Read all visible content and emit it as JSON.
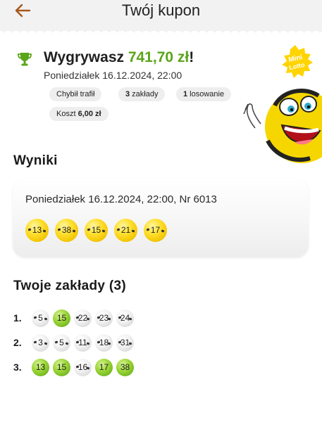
{
  "header": {
    "title": "Twój kupon"
  },
  "win": {
    "prefix": "Wygrywasz ",
    "amount": "741,70 zł",
    "suffix": "!",
    "date": "Poniedziałek 16.12.2024, 22:00"
  },
  "chips": {
    "chybil": "Chybił trafił",
    "bets_count": "3",
    "bets_label": " zakłady",
    "draws_count": "1",
    "draws_label": " losowanie",
    "cost_label": "Koszt ",
    "cost_value": "6,00 zł"
  },
  "brand": {
    "logo_line1": "Mini",
    "logo_line2": "Lotto"
  },
  "results": {
    "heading": "Wyniki",
    "draw_info": "Poniedziałek 16.12.2024, 22:00, Nr 6013",
    "numbers": [
      "13",
      "38",
      "15",
      "21",
      "17"
    ]
  },
  "bets": {
    "heading": "Twoje zakłady (3)",
    "rows": [
      {
        "label": "1.",
        "balls": [
          {
            "n": "5",
            "hit": false
          },
          {
            "n": "15",
            "hit": true
          },
          {
            "n": "22",
            "hit": false
          },
          {
            "n": "23",
            "hit": false
          },
          {
            "n": "24",
            "hit": false
          }
        ]
      },
      {
        "label": "2.",
        "balls": [
          {
            "n": "3",
            "hit": false
          },
          {
            "n": "5",
            "hit": false
          },
          {
            "n": "11",
            "hit": false
          },
          {
            "n": "18",
            "hit": false
          },
          {
            "n": "31",
            "hit": false
          }
        ]
      },
      {
        "label": "3.",
        "balls": [
          {
            "n": "13",
            "hit": true
          },
          {
            "n": "15",
            "hit": true
          },
          {
            "n": "16",
            "hit": false
          },
          {
            "n": "17",
            "hit": true
          },
          {
            "n": "38",
            "hit": true
          }
        ]
      }
    ]
  },
  "colors": {
    "accent_green": "#5aa51a",
    "back_arrow": "#a8571c",
    "ball_yellow": "#ffd400",
    "ball_green": "#8dcb2f"
  },
  "icons": {
    "back": "arrow-left-icon",
    "trophy": "trophy-icon"
  }
}
